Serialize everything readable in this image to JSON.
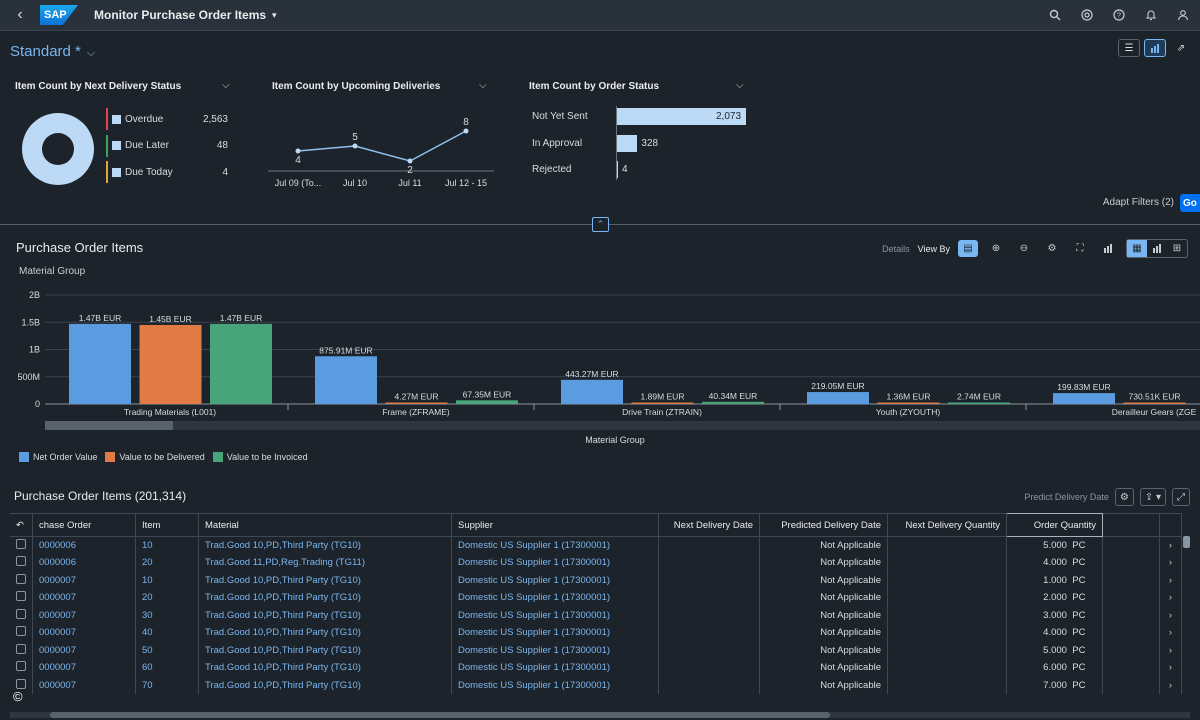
{
  "shell": {
    "title": "Monitor Purchase Order Items",
    "logo": "SAP"
  },
  "variant": "Standard *",
  "cards": {
    "delivery_status": {
      "title": "Item Count by Next Delivery Status",
      "items": [
        {
          "label": "Overdue",
          "value": "2,563",
          "color": "#e34352"
        },
        {
          "label": "Due Later",
          "value": "48",
          "color": "#3fa45b"
        },
        {
          "label": "Due Today",
          "value": "4",
          "color": "#e3a23b"
        }
      ]
    },
    "upcoming": {
      "title": "Item Count by Upcoming Deliveries",
      "points": [
        4,
        5,
        2,
        8
      ],
      "labels": [
        "Jul 09 (To...",
        "Jul 10",
        "Jul 11",
        "Jul 12 - 15"
      ]
    },
    "order_status": {
      "title": "Item Count by Order Status",
      "items": [
        {
          "label": "Not Yet Sent",
          "value": "2,073",
          "n": 2073
        },
        {
          "label": "In Approval",
          "value": "328",
          "n": 328
        },
        {
          "label": "Rejected",
          "value": "4",
          "n": 4
        }
      ]
    }
  },
  "filters": {
    "adapt": "Adapt Filters (2)",
    "go": "Go"
  },
  "section": {
    "title": "Purchase Order Items",
    "material_group": "Material Group",
    "details": "Details",
    "view_by": "View By"
  },
  "chart_data": {
    "type": "bar",
    "xlabel": "Material Group",
    "ylim": [
      0,
      2000000000
    ],
    "yticks": [
      "0",
      "500M",
      "1B",
      "1.5B",
      "2B"
    ],
    "categories": [
      "Trading Materials (L001)",
      "Frame (ZFRAME)",
      "Drive Train (ZTRAIN)",
      "Youth (ZYOUTH)",
      "Derailleur Gears (ZGE"
    ],
    "series": [
      {
        "name": "Net Order Value",
        "color": "#5b9bdf",
        "values": [
          1470000000,
          875910000,
          443270000,
          219050000,
          199830000
        ],
        "labels": [
          "1.47B EUR",
          "875.91M EUR",
          "443.27M EUR",
          "219.05M EUR",
          "199.83M EUR"
        ]
      },
      {
        "name": "Value to be Delivered",
        "color": "#e07b45",
        "values": [
          1450000000,
          4270000,
          1890000,
          1360000,
          730510
        ],
        "labels": [
          "1.45B EUR",
          "4.27M EUR",
          "1.89M EUR",
          "1.36M EUR",
          "730.51K EUR"
        ]
      },
      {
        "name": "Value to be Invoiced",
        "color": "#48a57a",
        "values": [
          1470000000,
          67350000,
          40340000,
          2740000,
          null
        ],
        "labels": [
          "1.47B EUR",
          "67.35M EUR",
          "40.34M EUR",
          "2.74M EUR",
          ""
        ]
      }
    ]
  },
  "table": {
    "title": "Purchase Order Items (201,314)",
    "predict": "Predict Delivery Date",
    "columns": [
      "chase Order",
      "Item",
      "Material",
      "Supplier",
      "Next Delivery Date",
      "Predicted Delivery Date",
      "Next Delivery Quantity",
      "Order Quantity"
    ],
    "rows": [
      [
        "0000006",
        "10",
        "Trad.Good 10,PD,Third Party (TG10)",
        "Domestic US Supplier 1 (17300001)",
        "",
        "Not Applicable",
        "",
        "5.000",
        "PC"
      ],
      [
        "0000006",
        "20",
        "Trad.Good 11,PD,Reg.Trading (TG11)",
        "Domestic US Supplier 1 (17300001)",
        "",
        "Not Applicable",
        "",
        "4.000",
        "PC"
      ],
      [
        "0000007",
        "10",
        "Trad.Good 10,PD,Third Party (TG10)",
        "Domestic US Supplier 1 (17300001)",
        "",
        "Not Applicable",
        "",
        "1.000",
        "PC"
      ],
      [
        "0000007",
        "20",
        "Trad.Good 10,PD,Third Party (TG10)",
        "Domestic US Supplier 1 (17300001)",
        "",
        "Not Applicable",
        "",
        "2.000",
        "PC"
      ],
      [
        "0000007",
        "30",
        "Trad.Good 10,PD,Third Party (TG10)",
        "Domestic US Supplier 1 (17300001)",
        "",
        "Not Applicable",
        "",
        "3.000",
        "PC"
      ],
      [
        "0000007",
        "40",
        "Trad.Good 10,PD,Third Party (TG10)",
        "Domestic US Supplier 1 (17300001)",
        "",
        "Not Applicable",
        "",
        "4.000",
        "PC"
      ],
      [
        "0000007",
        "50",
        "Trad.Good 10,PD,Third Party (TG10)",
        "Domestic US Supplier 1 (17300001)",
        "",
        "Not Applicable",
        "",
        "5.000",
        "PC"
      ],
      [
        "0000007",
        "60",
        "Trad.Good 10,PD,Third Party (TG10)",
        "Domestic US Supplier 1 (17300001)",
        "",
        "Not Applicable",
        "",
        "6.000",
        "PC"
      ],
      [
        "0000007",
        "70",
        "Trad.Good 10,PD,Third Party (TG10)",
        "Domestic US Supplier 1 (17300001)",
        "",
        "Not Applicable",
        "",
        "7.000",
        "PC"
      ]
    ]
  },
  "copyright": "©"
}
